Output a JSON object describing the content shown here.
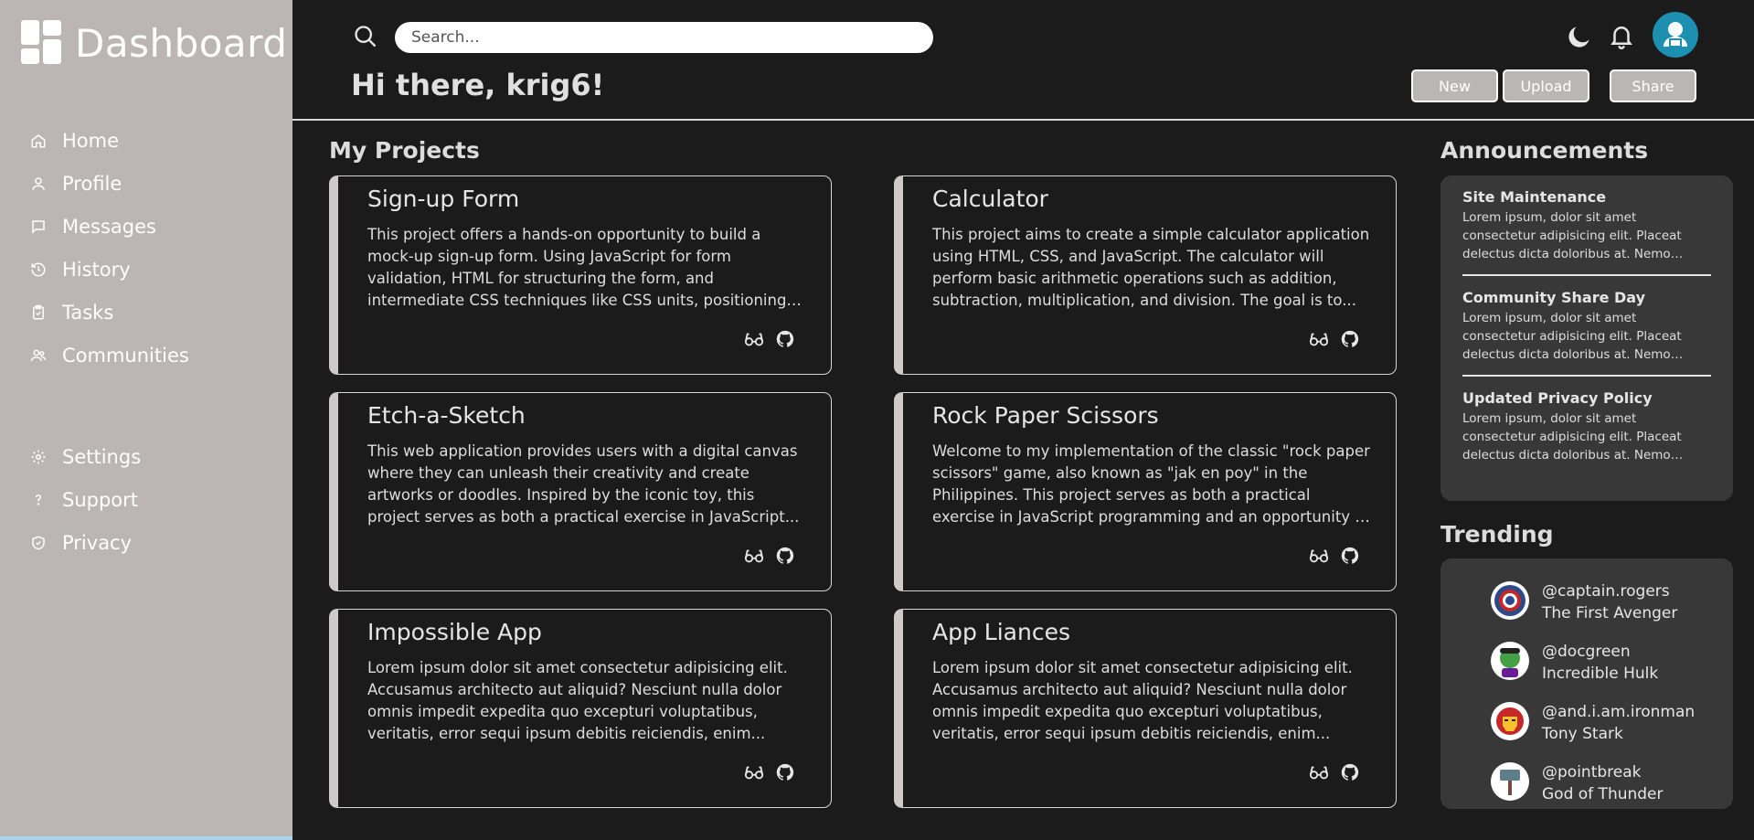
{
  "brand": {
    "title": "Dashboard"
  },
  "sidebar": {
    "primary": [
      {
        "label": "Home",
        "icon": "home-icon"
      },
      {
        "label": "Profile",
        "icon": "user-icon"
      },
      {
        "label": "Messages",
        "icon": "message-icon"
      },
      {
        "label": "History",
        "icon": "history-icon"
      },
      {
        "label": "Tasks",
        "icon": "clipboard-check-icon"
      },
      {
        "label": "Communities",
        "icon": "users-icon"
      }
    ],
    "secondary": [
      {
        "label": "Settings",
        "icon": "gear-icon"
      },
      {
        "label": "Support",
        "icon": "question-icon"
      },
      {
        "label": "Privacy",
        "icon": "shield-icon"
      }
    ]
  },
  "header": {
    "search_placeholder": "Search...",
    "greeting": "Hi there, krig6!",
    "buttons": {
      "new": "New",
      "upload": "Upload",
      "share": "Share"
    }
  },
  "projects": {
    "title": "My Projects",
    "items": [
      {
        "title": "Sign-up Form",
        "description": "This project offers a hands-on opportunity to build a mock-up sign-up form. Using JavaScript for form validation, HTML for structuring the form, and intermediate CSS techniques like CSS units, positioning, and advanced selectors, you'll..."
      },
      {
        "title": "Calculator",
        "description": "This project aims to create a simple calculator application using HTML, CSS, and JavaScript. The calculator will perform basic arithmetic operations such as addition, subtraction, multiplication, and division. The goal is to..."
      },
      {
        "title": "Etch-a-Sketch",
        "description": "This web application provides users with a digital canvas where they can unleash their creativity and create artworks or doodles. Inspired by the iconic toy, this project serves as both a practical exercise in JavaScript..."
      },
      {
        "title": "Rock Paper Scissors",
        "description": "Welcome to my implementation of the classic \"rock paper scissors\" game, also known as \"jak en poy\" in the Philippines. This project serves as both a practical exercise in JavaScript programming and an opportunity to explore..."
      },
      {
        "title": "Impossible App",
        "description": "Lorem ipsum dolor sit amet consectetur adipisicing elit. Accusamus architecto aut aliquid? Nesciunt nulla dolor omnis impedit expedita quo excepturi voluptatibus, veritatis, error sequi ipsum debitis reiciendis, enim..."
      },
      {
        "title": "App Liances",
        "description": "Lorem ipsum dolor sit amet consectetur adipisicing elit. Accusamus architecto aut aliquid? Nesciunt nulla dolor omnis impedit expedita quo excepturi voluptatibus, veritatis, error sequi ipsum debitis reiciendis, enim..."
      }
    ]
  },
  "announcements": {
    "title": "Announcements",
    "items": [
      {
        "title": "Site Maintenance",
        "body": "Lorem ipsum, dolor sit amet consectetur adipisicing elit. Placeat delectus dicta doloribus at. Nemo praesentium quaerat..."
      },
      {
        "title": "Community Share Day",
        "body": "Lorem ipsum, dolor sit amet consectetur adipisicing elit. Placeat delectus dicta doloribus at. Nemo praesentium quaerat..."
      },
      {
        "title": "Updated Privacy Policy",
        "body": "Lorem ipsum, dolor sit amet consectetur adipisicing elit. Placeat delectus dicta doloribus at. Nemo praesentium quaerat..."
      }
    ]
  },
  "trending": {
    "title": "Trending",
    "items": [
      {
        "handle": "@captain.rogers",
        "name": "The First Avenger"
      },
      {
        "handle": "@docgreen",
        "name": "Incredible Hulk"
      },
      {
        "handle": "@and.i.am.ironman",
        "name": "Tony Stark"
      },
      {
        "handle": "@pointbreak",
        "name": "God of Thunder"
      }
    ]
  },
  "colors": {
    "sidebar_bg": "#bcb5b5",
    "main_bg": "#1b1b1b",
    "panel_bg": "#383838",
    "avatar_bg": "#1d8fb0"
  }
}
